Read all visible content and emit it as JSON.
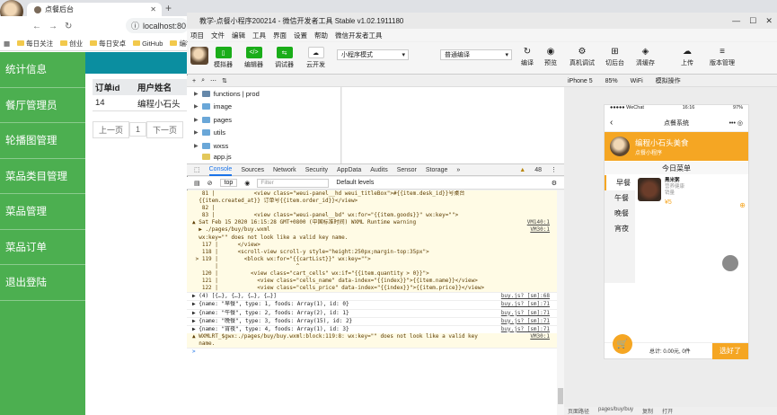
{
  "browser": {
    "tab_title": "点餐后台",
    "url": "localhost:80",
    "bookmarks": [
      "每日关注",
      "创业",
      "每日安卓",
      "GitHub",
      "编程"
    ]
  },
  "admin": {
    "sidebar": [
      "统计信息",
      "餐厅管理员",
      "轮播图管理",
      "菜品类目管理",
      "菜品管理",
      "菜品订单",
      "退出登陆"
    ],
    "table_headers": [
      "订单id",
      "用户姓名"
    ],
    "row": [
      "14",
      "编程小石头"
    ],
    "pager": [
      "上一页",
      "1",
      "下一页"
    ]
  },
  "devtool": {
    "title": "教学-点餐小程序200214 - 微信开发者工具 Stable v1.02.1911180",
    "menu": [
      "项目",
      "文件",
      "编辑",
      "工具",
      "界面",
      "设置",
      "帮助",
      "微信开发者工具"
    ],
    "toolbar_buttons": [
      "模拟器",
      "编辑器",
      "调试器",
      "云开发",
      "编译",
      "预览",
      "真机调试",
      "切后台",
      "清缓存",
      "上传",
      "版本管理"
    ],
    "mode_select": "小程序模式",
    "compile_select": "普通编译",
    "device": "iPhone 5",
    "zoom": "85%",
    "network": "WiFi",
    "sim_op": "模拟操作",
    "tree": [
      {
        "name": "functions | prod",
        "type": "cloud"
      },
      {
        "name": "image",
        "type": "folder"
      },
      {
        "name": "pages",
        "type": "folder"
      },
      {
        "name": "utils",
        "type": "folder"
      },
      {
        "name": "wxss",
        "type": "folder"
      },
      {
        "name": "app.js",
        "type": "file"
      }
    ],
    "console_tabs": [
      "Console",
      "Sources",
      "Network",
      "Security",
      "AppData",
      "Audits",
      "Sensor",
      "Storage"
    ],
    "warn_count": "48",
    "context": "top",
    "filter_placeholder": "Filter",
    "levels": "Default levels",
    "console_lines": [
      {
        "t": "   81 |            <view class=\"weui-panel__hd weui_titleBox\">#{{item.desk_id}}号桌台",
        "w": true,
        "l": ""
      },
      {
        "t": "  {{item.created_at}} 订单号{{item.order_id}}</view>",
        "w": true,
        "l": ""
      },
      {
        "t": "   82 |",
        "w": true,
        "l": ""
      },
      {
        "t": "   83 |            <view class=\"weui-panel__bd\" wx:for=\"{{item.goods}}\" wx:key=\"\">",
        "w": true,
        "l": ""
      },
      {
        "t": "▲ Sat Feb 15 2020 16:15:28 GMT+0800 (中国标准时间) WXML Runtime warning",
        "w": true,
        "l": "VM140:1"
      },
      {
        "t": "  ▶ ./pages/buy/buy.wxml",
        "w": true,
        "l": "VM30:1"
      },
      {
        "t": "  wx:key=\"\" does not look like a valid key name.",
        "w": true,
        "l": ""
      },
      {
        "t": "   117 |      </view>",
        "w": true,
        "l": ""
      },
      {
        "t": "   118 |      <scroll-view scroll-y style=\"height:250px;margin-top:35px\">",
        "w": true,
        "l": ""
      },
      {
        "t": " > 119 |        <block wx:for=\"{{cartList}}\" wx:key=\"\">",
        "w": true,
        "l": ""
      },
      {
        "t": "       |                        ^",
        "w": true,
        "l": ""
      },
      {
        "t": "   120 |          <view class=\"cart_cells\" wx:if=\"{{item.quantity > 0}}\">",
        "w": true,
        "l": ""
      },
      {
        "t": "   121 |            <view class=\"cells_name\" data-index=\"{{index}}\">{{item.name}}</view>",
        "w": true,
        "l": ""
      },
      {
        "t": "   122 |            <view class=\"cells_price\" data-index=\"{{index}}\">{{item.price}}</view>",
        "w": true,
        "l": ""
      },
      {
        "t": "▶ (4) [{…}, {…}, {…}, {…}]",
        "w": false,
        "l": "buy.js? [sm]:68"
      },
      {
        "t": "▶ {name: \"早餐\", type: 1, foods: Array(1), id: 0}",
        "w": false,
        "l": "buy.js? [sm]:71"
      },
      {
        "t": "▶ {name: \"午餐\", type: 2, foods: Array(2), id: 1}",
        "w": false,
        "l": "buy.js? [sm]:71"
      },
      {
        "t": "▶ {name: \"晚餐\", type: 3, foods: Array(15), id: 2}",
        "w": false,
        "l": "buy.js? [sm]:71"
      },
      {
        "t": "▶ {name: \"宵夜\", type: 4, foods: Array(1), id: 3}",
        "w": false,
        "l": "buy.js? [sm]:71"
      },
      {
        "t": "▲ WXMLRT_$gwx:./pages/buy/buy.wxml:block:119:8: wx:key=\"\" does not look like a valid key",
        "w": true,
        "l": "VM30:1"
      },
      {
        "t": "  name.",
        "w": true,
        "l": ""
      },
      {
        "t": ">",
        "w": false,
        "l": ""
      }
    ]
  },
  "phone": {
    "carrier": "●●●●● WeChat",
    "time": "16:16",
    "battery": "97%",
    "nav_title": "点餐系统",
    "shop_name": "编程小石头美食",
    "shop_sub": "点餐小程序",
    "menu_title": "今日菜单",
    "categories": [
      "早餐",
      "午餐",
      "晚餐",
      "宵夜"
    ],
    "food_name": "黑米粥",
    "food_desc": "营养健康",
    "food_sold": "销量",
    "food_price": "¥5",
    "total": "总计: 0.00元, 0件",
    "checkout": "选好了",
    "bottom_path": "页面路径",
    "bottom_page": "pages/buy/buy",
    "bottom_copy": "复制",
    "bottom_open": "打开"
  }
}
